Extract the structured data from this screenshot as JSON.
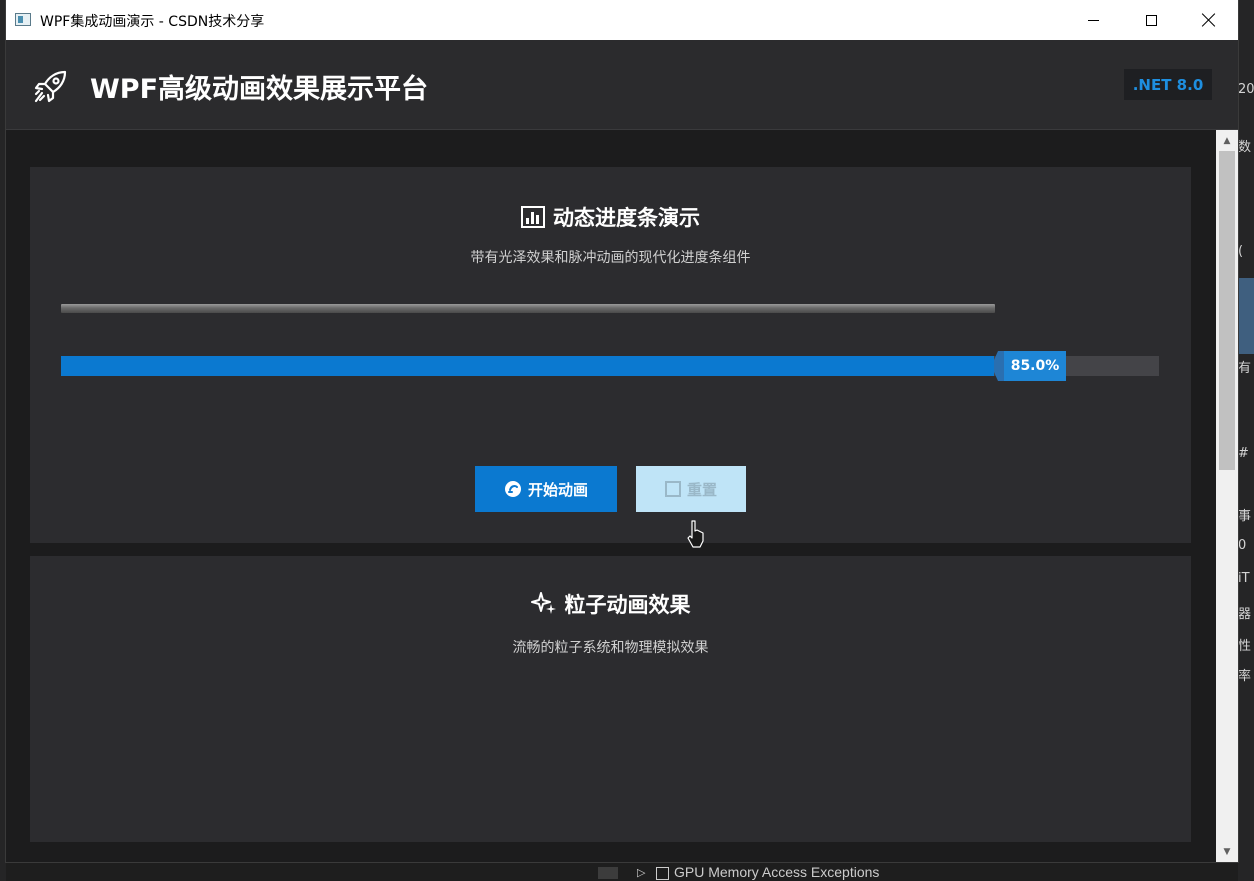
{
  "window": {
    "title": "WPF集成动画演示 - CSDN技术分享",
    "minimize_glyph": "",
    "controls": [
      "minimize",
      "maximize",
      "close"
    ]
  },
  "header": {
    "logo_icon": "rocket-icon",
    "title": "WPF高级动画效果展示平台",
    "badge": ".NET 8.0"
  },
  "progress_card": {
    "icon": "bar-chart-icon",
    "title": "动态进度条演示",
    "subtitle": "带有光泽效果和脉冲动画的现代化进度条组件",
    "progress_value": 0.85,
    "progress_label": "85.0%",
    "start_button": "开始动画",
    "reset_button": "重置"
  },
  "particle_card": {
    "icon": "sparkle-icon",
    "title": "粒子动画效果",
    "subtitle": "流畅的粒子系统和物理模拟效果"
  },
  "background": {
    "right_fragments": [
      "20",
      "数",
      "(",
      "有",
      "#",
      "事",
      "0",
      "iT",
      "器",
      "性",
      "率"
    ],
    "bottom_text": "GPU Memory Access Exceptions"
  },
  "colors": {
    "accent": "#0b79d0",
    "badge_text": "#1e8fe0",
    "card_bg": "#2c2c2f",
    "reset_bg": "#bfe4f7"
  }
}
